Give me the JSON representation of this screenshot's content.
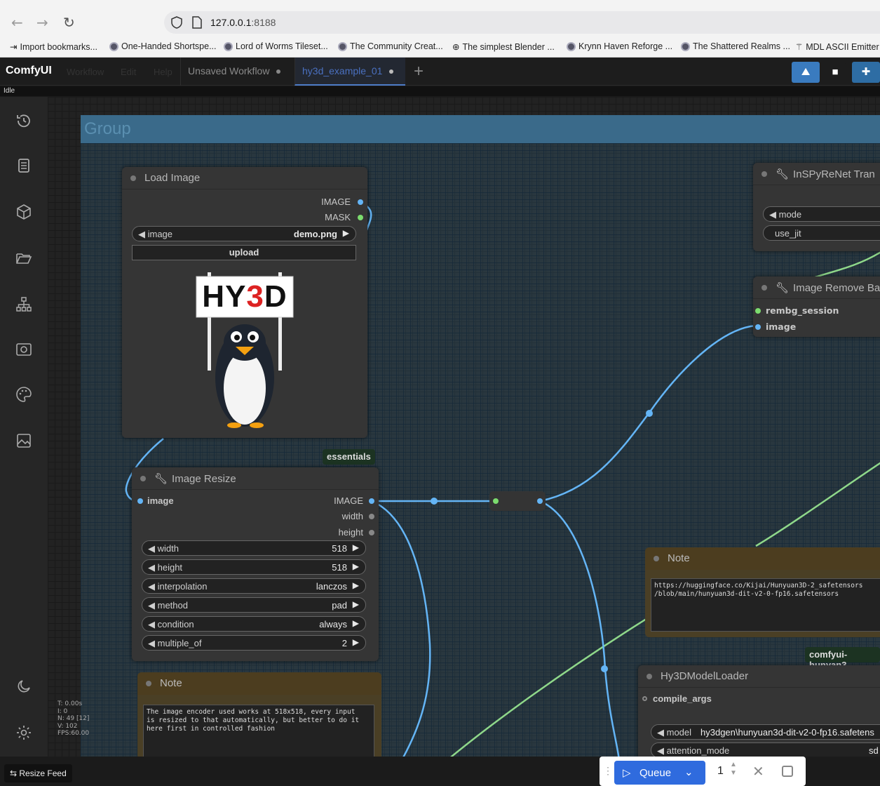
{
  "browser": {
    "url_host": "127.0.0.1",
    "url_port": ":8188",
    "bookmarks": [
      "Import bookmarks...",
      "One-Handed Shortspe...",
      "Lord of Worms Tileset...",
      "The Community Creat...",
      "The simplest Blender ...",
      "Krynn Haven Reforge ...",
      "The Shattered Realms ...",
      "MDL ASCII Emitter"
    ]
  },
  "app": {
    "logo": "ComfyUI",
    "menu": [
      "Workflow",
      "Edit",
      "Help"
    ],
    "tabs": [
      "Unsaved Workflow",
      "hy3d_example_01"
    ],
    "status": "Idle"
  },
  "stats": [
    "T: 0.00s",
    "I: 0",
    "N: 49 [12]",
    "V: 102",
    "FPS:60.00"
  ],
  "group": {
    "title": "Group"
  },
  "load_image": {
    "title": "Load Image",
    "outputs": [
      "IMAGE",
      "MASK"
    ],
    "image_label": "image",
    "image_value": "demo.png",
    "upload_label": "upload",
    "preview_sign": "HY3D"
  },
  "badges": {
    "essentials": "essentials",
    "hunyuan": "comfyui-hunyan3"
  },
  "image_resize": {
    "title": "Image Resize",
    "input": "image",
    "outputs": [
      "IMAGE",
      "width",
      "height"
    ],
    "widgets": [
      {
        "label": "width",
        "value": "518"
      },
      {
        "label": "height",
        "value": "518"
      },
      {
        "label": "interpolation",
        "value": "lanczos"
      },
      {
        "label": "method",
        "value": "pad"
      },
      {
        "label": "condition",
        "value": "always"
      },
      {
        "label": "multiple_of",
        "value": "2"
      }
    ]
  },
  "note1": {
    "title": "Note",
    "text": "The image encoder used works at 518x518, every input\nis resized to that automatically, but better to do it\nhere first in controlled fashion"
  },
  "note2": {
    "title": "Note",
    "text": "https://huggingface.co/Kijai/Hunyuan3D-2_safetensors\n/blob/main/hunyuan3d-dit-v2-0-fp16.safetensors"
  },
  "inspyrenet": {
    "title": "InSPyReNet Tran",
    "widgets": [
      "mode",
      "use_jit"
    ]
  },
  "remove_bg": {
    "title": "Image Remove Ba",
    "inputs": [
      "rembg_session",
      "image"
    ]
  },
  "model_loader": {
    "title": "Hy3DModelLoader",
    "input": "compile_args",
    "model_label": "model",
    "model_value": "hy3dgen\\hunyuan3d-dit-v2-0-fp16.safetens",
    "attention_label": "attention_mode",
    "attention_value": "sd"
  },
  "bottom": {
    "resize_feed": "Resize Feed",
    "queue_label": "Queue",
    "queue_count": "1"
  }
}
